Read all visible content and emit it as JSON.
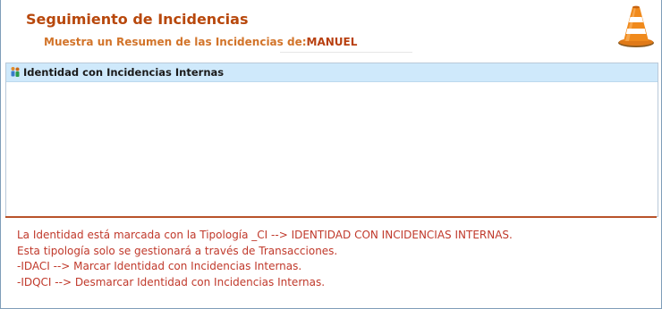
{
  "header": {
    "title": "Seguimiento de Incidencias",
    "subtitle_prefix": "Muestra un Resumen de las Incidencias de:",
    "user": "MANUEL",
    "icon": "traffic-cone-icon"
  },
  "list": {
    "items": [
      {
        "label": "Identidad con Incidencias Internas",
        "icon": "identity-icon",
        "selected": true
      }
    ]
  },
  "description": {
    "lines": [
      "La Identidad está marcada con la Tipología _CI --> IDENTIDAD CON INCIDENCIAS INTERNAS.",
      "Esta tipología solo se gestionará a través de Transacciones.",
      "-IDACI --> Marcar Identidad con Incidencias Internas.",
      "-IDQCI --> Desmarcar Identidad con Incidencias Internas."
    ]
  },
  "colors": {
    "title": "#b8480c",
    "subtitle": "#d2742a",
    "description": "#c0392b",
    "selected_row": "#cfe9fb",
    "divider": "#b8532a"
  }
}
